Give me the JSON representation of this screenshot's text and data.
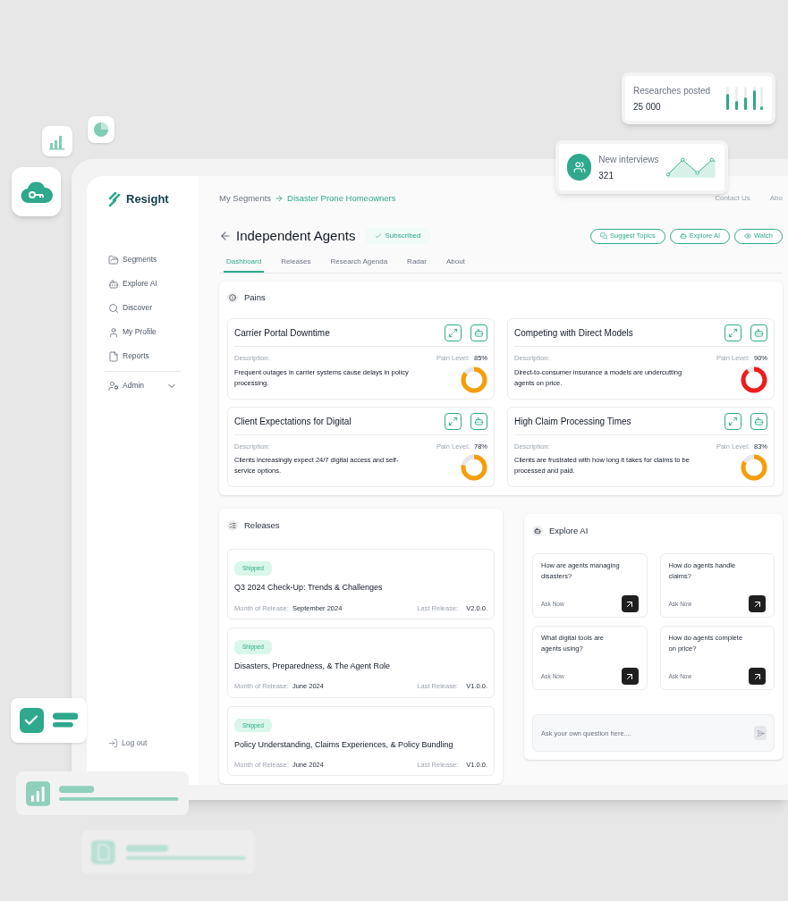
{
  "stats": [
    {
      "label": "Researches posted",
      "value": "25 000"
    },
    {
      "label": "New interviews",
      "value": "321"
    }
  ],
  "brand": {
    "name": "Resight"
  },
  "sidebar": {
    "items": [
      {
        "label": "Segments"
      },
      {
        "label": "Explore AI"
      },
      {
        "label": "Discover"
      },
      {
        "label": "My Profile"
      },
      {
        "label": "Reports"
      }
    ],
    "admin": {
      "label": "Admin",
      "expanded": false
    },
    "logout": "Log out"
  },
  "breadcrumb": [
    "My Segments",
    "Disaster Prone Homeowners"
  ],
  "top_links": [
    "Contact Us",
    "Abo"
  ],
  "page": {
    "title": "Independent Agents",
    "badge": "Subscribed"
  },
  "actions": [
    "Suggest Topics",
    "Explore AI",
    "Watch"
  ],
  "tabs": [
    {
      "label": "Dashboard",
      "selected": true
    },
    {
      "label": "Releases",
      "selected": false
    },
    {
      "label": "Research Agenda",
      "selected": false
    },
    {
      "label": "Radar",
      "selected": false
    },
    {
      "label": "About",
      "selected": false
    }
  ],
  "pains": {
    "title": "Pains",
    "items": [
      {
        "title": "Carrier Portal Downtime",
        "description_label": "Description:",
        "description": "Frequent outages in carrier systems cause delays in policy processing.",
        "level_label": "Pain Level:",
        "reading": "85%",
        "level": 0.85,
        "color": "#f59e0b"
      },
      {
        "title": "Competing with Direct Models",
        "description_label": "Description:",
        "description": "Direct-to-consumer insurance a models are undercutting agents on price.",
        "level_label": "Pain Level:",
        "reading": "90%",
        "level": 0.9,
        "color": "#ef1c1c"
      },
      {
        "title": "Client Expectations for Digital",
        "description_label": "Description:",
        "description": "Clients increasingly expect 24/7 digital access and self-service options.",
        "level_label": "Pain Level:",
        "reading": "78%",
        "level": 0.78,
        "color": "#f59e0b"
      },
      {
        "title": "High Claim Processing Times",
        "description_label": "Description:",
        "description": "Clients are frustrated with how long it takes for claims to be processed and paid.",
        "level_label": "Pain Level:",
        "reading": "83%",
        "level": 0.83,
        "color": "#f59e0b"
      }
    ]
  },
  "releases": {
    "title": "Releases",
    "items": [
      {
        "status": "Shipped",
        "title": "Q3 2024 Check-Up: Trends & Challenges",
        "month_label": "Month of Release:",
        "month": "September 2024",
        "last_label": "Last Release:",
        "version": "V2.0.0."
      },
      {
        "status": "Shipped",
        "title": "Disasters, Preparedness, & The Agent Role",
        "month_label": "Month of Release:",
        "month": "June 2024",
        "last_label": "Last Release:",
        "version": "V1.0.0."
      },
      {
        "status": "Shipped",
        "title": "Policy Understanding, Claims Experiences, & Policy Bundling",
        "month_label": "Month of Release:",
        "month": "June 2024",
        "last_label": "Last Release:",
        "version": "V1.0.0."
      }
    ]
  },
  "explore_ai": {
    "title": "Explore AI",
    "questions": [
      {
        "text": "How are agents managing disasters?",
        "action": "Ask Now"
      },
      {
        "text": "How do agents handle claims?",
        "action": "Ask Now"
      },
      {
        "text": "What digital tools are agents using?",
        "action": "Ask Now"
      },
      {
        "text": "How do agents complete on price?",
        "action": "Ask Now"
      }
    ],
    "input": {
      "placeholder": "Ask your own question here...."
    }
  }
}
